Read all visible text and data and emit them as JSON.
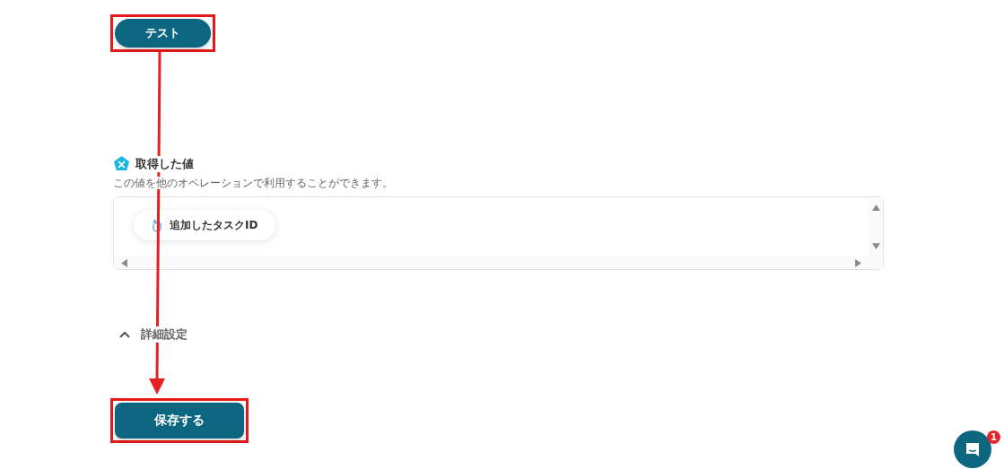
{
  "test_button": {
    "label": "テスト",
    "highlighted": true
  },
  "output": {
    "title": "取得した値",
    "description": "この値を他のオペレーションで利用することができます。",
    "values": [
      {
        "label": "追加したタスクID"
      }
    ]
  },
  "advanced_settings": {
    "label": "詳細設定",
    "expanded": true
  },
  "save_button": {
    "label": "保存する",
    "highlighted": true
  },
  "chat": {
    "badge": "1"
  }
}
